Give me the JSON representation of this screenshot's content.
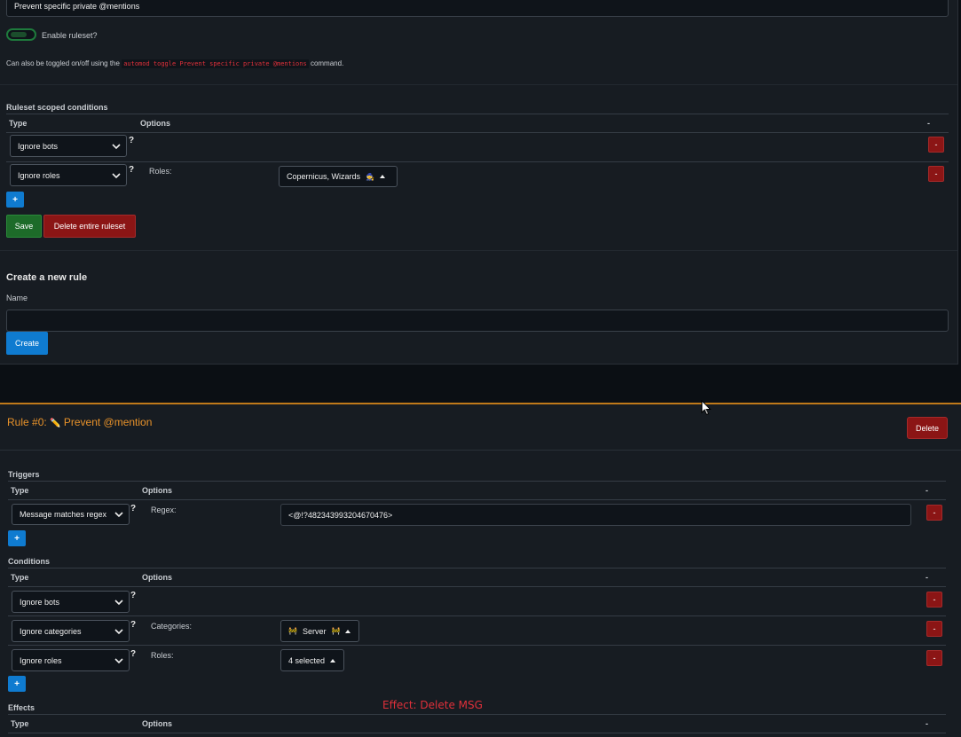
{
  "ruleset": {
    "name_value": "Prevent specific private @mentions",
    "enable_label": "Enable ruleset?",
    "hint_prefix": "Can also be toggled on/off using the",
    "hint_command": "automod toggle Prevent specific private @mentions",
    "hint_suffix": "command.",
    "conditions_title": "Ruleset scoped conditions",
    "col_type": "Type",
    "col_options": "Options",
    "col_dash": "-",
    "conditions": [
      {
        "type": "Ignore bots"
      },
      {
        "type": "Ignore roles",
        "option_label": "Roles:",
        "option_value": "Copernicus, Wizards",
        "option_icon": "wizard-emoji"
      }
    ],
    "add_label": "+",
    "remove_label": "-",
    "save_label": "Save",
    "delete_label": "Delete entire ruleset"
  },
  "new_rule": {
    "title": "Create a new rule",
    "name_label": "Name",
    "name_value": "",
    "create_label": "Create"
  },
  "rule": {
    "title_prefix": "Rule #0:",
    "title_name": "Prevent @mention",
    "title_icon": "pencil-emoji",
    "delete_label": "Delete",
    "accent_color": "#e8922a",
    "triggers_title": "Triggers",
    "triggers": [
      {
        "type": "Message matches regex",
        "option_label": "Regex:",
        "option_value": "<@!?482343993204670476>"
      }
    ],
    "conditions_title": "Conditions",
    "conditions": [
      {
        "type": "Ignore bots"
      },
      {
        "type": "Ignore categories",
        "option_label": "Categories:",
        "option_value": "Server",
        "option_icon": "barrier-emoji"
      },
      {
        "type": "Ignore roles",
        "option_label": "Roles:",
        "option_value": "4 selected"
      }
    ],
    "effects_title": "Effects",
    "col_type": "Type",
    "col_options": "Options",
    "col_dash": "-"
  },
  "annotation": {
    "text": "Effect: Delete MSG",
    "color": "#e0303a"
  }
}
